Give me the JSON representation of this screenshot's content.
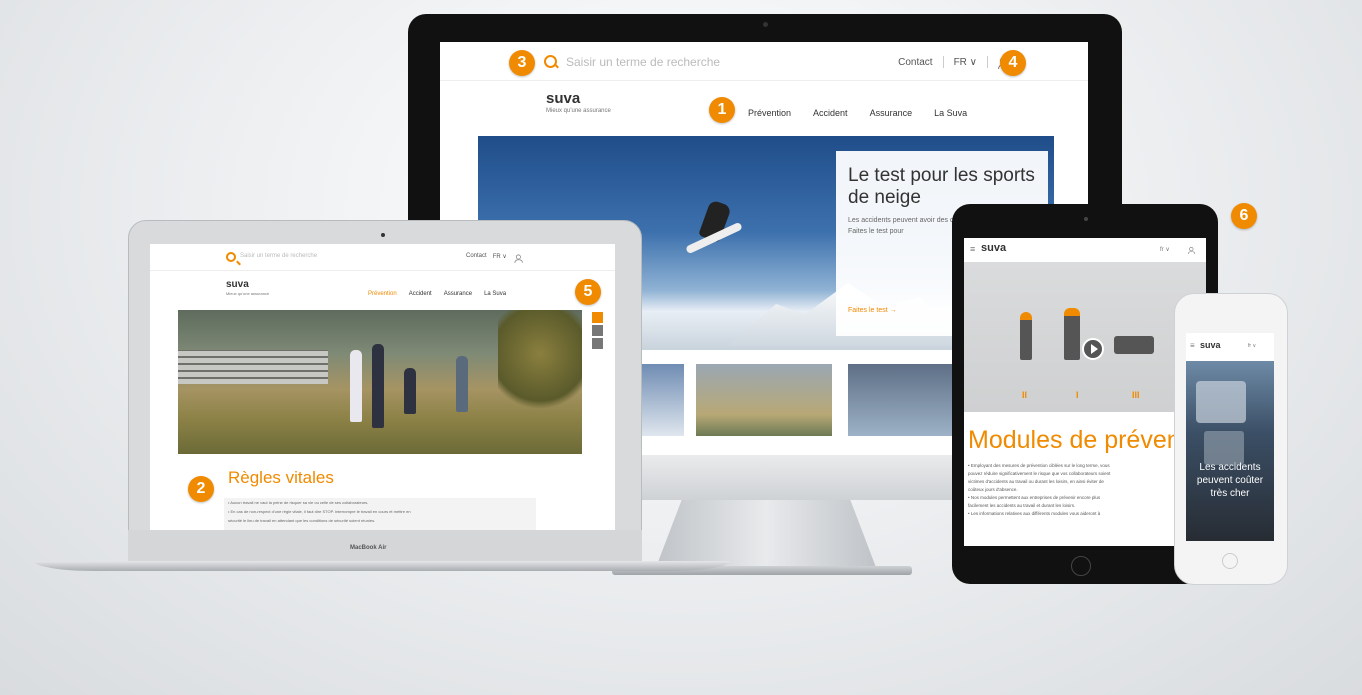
{
  "badges": [
    "1",
    "2",
    "3",
    "4",
    "5",
    "6"
  ],
  "desktop": {
    "search_placeholder": "Saisir un terme de recherche",
    "contact": "Contact",
    "lang": "FR ∨",
    "logo": "suva",
    "tagline": "Mieux qu'une assurance",
    "nav": [
      "Prévention",
      "Accident",
      "Assurance",
      "La Suva"
    ],
    "card_title": "Le test pour les sports de neige",
    "card_text": "Les accidents peuvent avoir des conséquences graves. Faites le test pour",
    "card_cta": "Faites le test →"
  },
  "laptop": {
    "search_placeholder": "Saisir un terme de recherche",
    "contact": "Contact",
    "lang": "FR ∨",
    "logo": "suva",
    "tagline": "Mieux qu'une assurance",
    "nav": [
      "Prévention",
      "Accident",
      "Assurance",
      "La Suva"
    ],
    "heading": "Règles vitales",
    "body_lines": [
      "• Aucun travail ne vaut la peine de risquer sa vie ou celle de ses collaborateurs.",
      "• En cas de non-respect d'une règle vitale, il faut dire STOP. Interrompre le travail en cours et mettre en",
      "  sécurité le lieu de travail en attendant que les conditions de sécurité soient réunies."
    ],
    "brand": "MacBook Air"
  },
  "tablet": {
    "logo": "suva",
    "lang": "fr ∨",
    "counts": [
      "II",
      "I",
      "III"
    ],
    "title": "Modules de prévention",
    "body_lines": [
      "• Employant des mesures de prévention ciblées sur le long terme, vous",
      "  pouvez réduire significativement le risque que vos collaborateurs soient",
      "  victimes d'accidents au travail ou durant les loisirs, en ainsi éviter de",
      "  coûteux jours d'absence.",
      "• Nos modules permettent aux entreprises de prévenir encore plus",
      "  facilement les accidents au travail et durant les loisirs.",
      "• Les informations relatives aux différents modules vous aideront à"
    ]
  },
  "phone": {
    "logo": "suva",
    "lang": "fr ∨",
    "text": "Les accidents peuvent coûter très cher"
  },
  "colors": {
    "accent": "#f08a00",
    "dark": "#111111"
  }
}
